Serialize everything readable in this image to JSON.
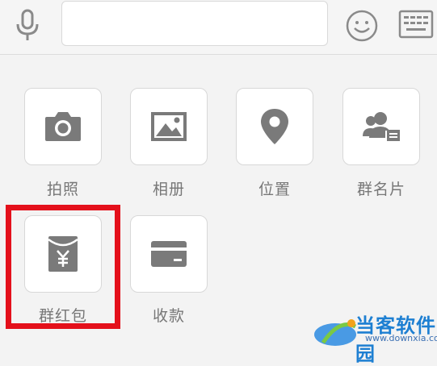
{
  "input_bar": {
    "mic_icon": "microphone-icon",
    "input_value": "",
    "emoji_icon": "smiley-icon",
    "keyboard_icon": "keyboard-icon"
  },
  "panel": {
    "items": [
      {
        "label": "拍照",
        "icon": "camera-icon"
      },
      {
        "label": "相册",
        "icon": "image-icon"
      },
      {
        "label": "位置",
        "icon": "location-pin-icon"
      },
      {
        "label": "群名片",
        "icon": "contact-card-icon"
      },
      {
        "label": "群红包",
        "icon": "red-packet-icon"
      },
      {
        "label": "收款",
        "icon": "card-icon"
      }
    ]
  },
  "highlight_color": "#e4101b",
  "watermark": {
    "title": "当客软件园",
    "url": "www.downxia.com"
  }
}
